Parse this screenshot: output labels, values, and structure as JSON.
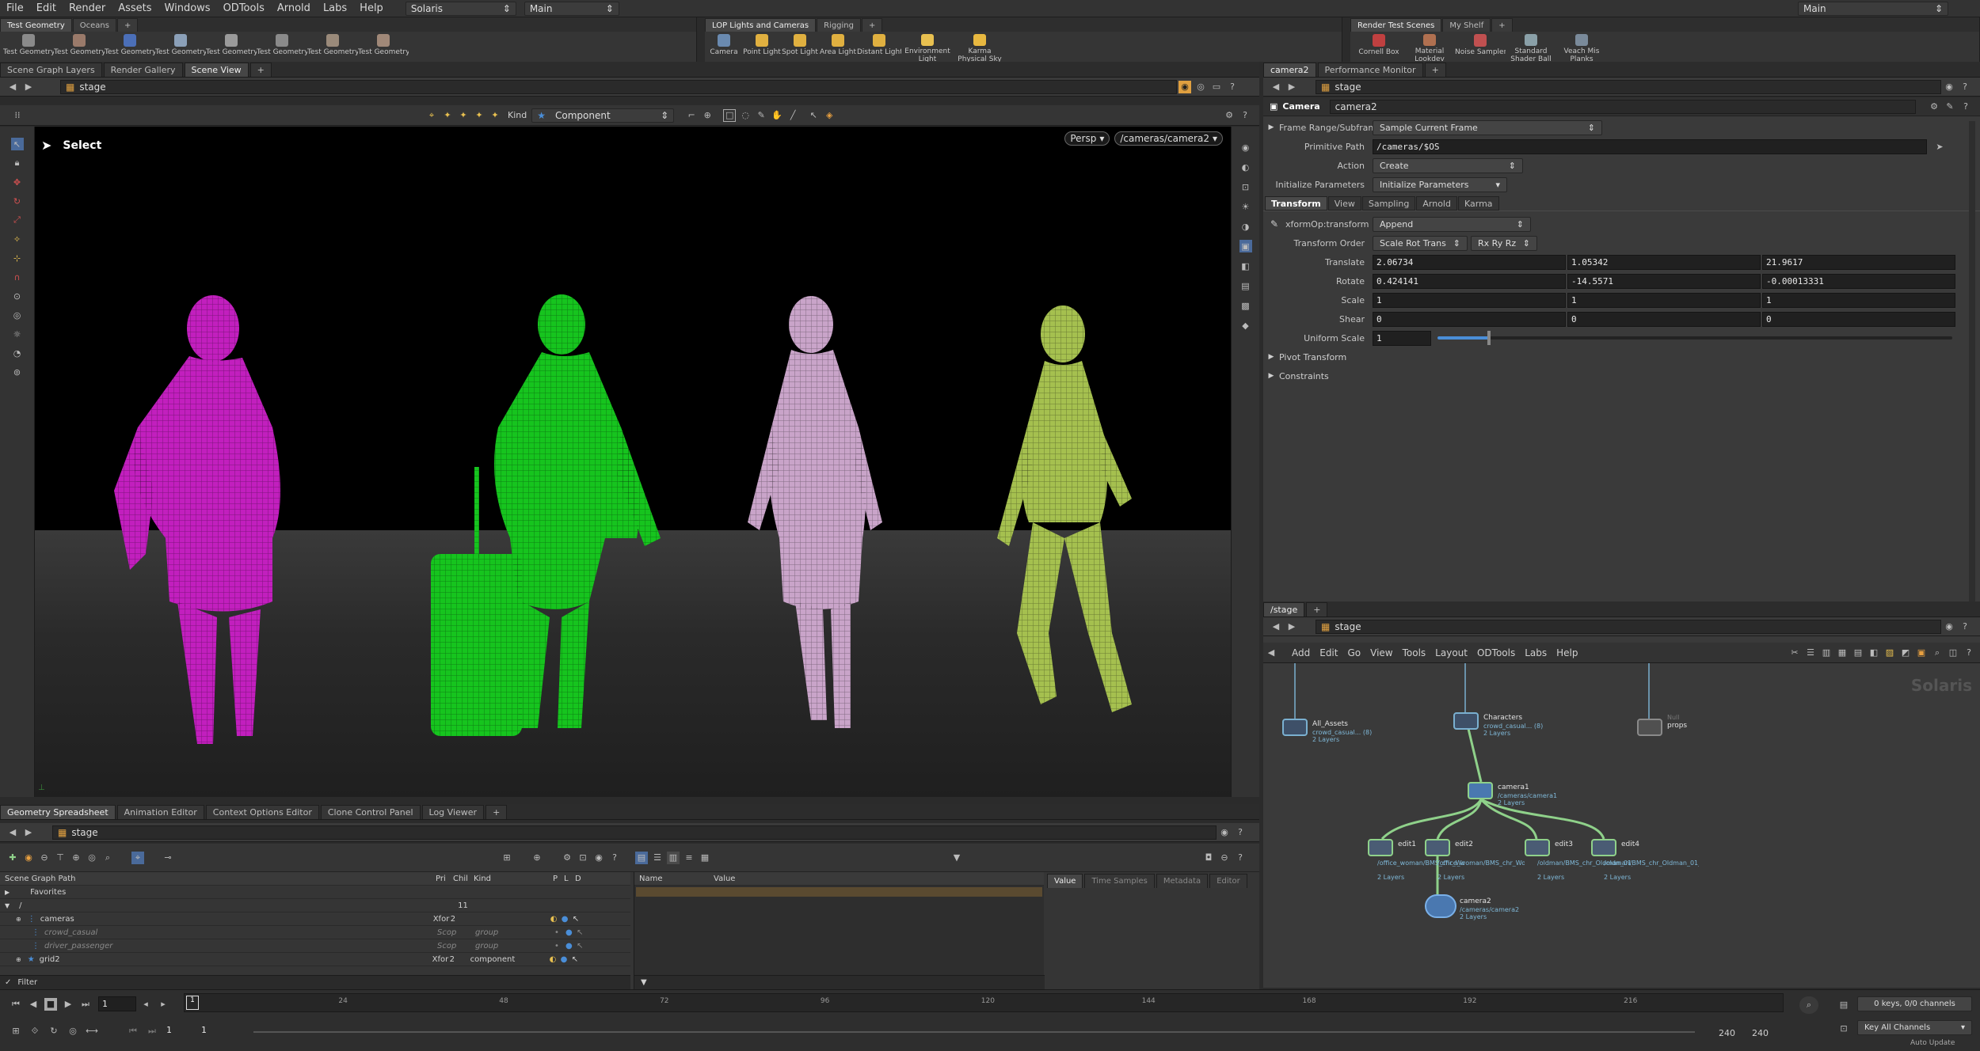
{
  "menubar": {
    "items": [
      "File",
      "Edit",
      "Render",
      "Assets",
      "Windows",
      "ODTools",
      "Arnold",
      "Labs",
      "Help"
    ],
    "desktop": "Solaris",
    "context": "Main",
    "right_context": "Main"
  },
  "shelf": {
    "left": {
      "tabs": [
        "Test Geometry",
        "Oceans"
      ],
      "tools": [
        "Test Geometry: C",
        "Test Geometry: P",
        "Test Geometry: R",
        "Test Geometry: S",
        "Test Geometry: S",
        "Test Geometry: T",
        "Test Geometry: T",
        "Test Geometry: T"
      ]
    },
    "mid": {
      "tabs": [
        "LOP Lights and Cameras",
        "Rigging"
      ],
      "tools": [
        "Camera",
        "Point Light",
        "Spot Light",
        "Area Light",
        "Distant Light",
        "Environment Light",
        "Karma Physical Sky"
      ]
    },
    "right": {
      "tabs": [
        "Render Test Scenes",
        "My Shelf"
      ],
      "tools": [
        "Cornell Box",
        "Material Lookdev",
        "Noise Sampler",
        "Standard Shader Ball",
        "Veach Mis Planks"
      ]
    }
  },
  "viewer": {
    "tabs": [
      "Scene Graph Layers",
      "Render Gallery",
      "Scene View"
    ],
    "path": "stage",
    "kind_label": "Kind",
    "kind_value": "Component",
    "select_label": "Select",
    "persp": "Persp",
    "camera": "/cameras/camera2"
  },
  "params": {
    "tabs": [
      "camera2",
      "Performance Monitor"
    ],
    "path": "stage",
    "node_type": "Camera",
    "node_name": "camera2",
    "frame_range_label": "Frame Range/Subframes",
    "frame_range_value": "Sample Current Frame",
    "primitive_path_label": "Primitive Path",
    "primitive_path_value": "/cameras/$OS",
    "action_label": "Action",
    "action_value": "Create",
    "init_label": "Initialize Parameters",
    "init_value": "Initialize Parameters",
    "sub_tabs": [
      "Transform",
      "View",
      "Sampling",
      "Arnold",
      "Karma"
    ],
    "xform_label": "xformOp:transform",
    "xform_value": "Append",
    "order_label": "Transform Order",
    "order_value": "Scale Rot Trans",
    "rot_order": "Rx Ry Rz",
    "translate_label": "Translate",
    "translate": [
      "2.06734",
      "1.05342",
      "21.9617"
    ],
    "rotate_label": "Rotate",
    "rotate": [
      "0.424141",
      "-14.5571",
      "-0.00013331"
    ],
    "scale_label": "Scale",
    "scale": [
      "1",
      "1",
      "1"
    ],
    "shear_label": "Shear",
    "shear": [
      "0",
      "0",
      "0"
    ],
    "uniform_label": "Uniform Scale",
    "uniform_value": "1",
    "uniform_fraction": 0.1,
    "pivot_label": "Pivot Transform",
    "constraints_label": "Constraints"
  },
  "network": {
    "tab": "/stage",
    "path": "stage",
    "menu": [
      "Add",
      "Edit",
      "Go",
      "View",
      "Tools",
      "Layout",
      "ODTools",
      "Labs",
      "Help"
    ],
    "watermark": "Solaris",
    "nodes": {
      "all_assets": {
        "name": "All_Assets",
        "sub": "crowd_casual... (8)",
        "layers": "2 Layers"
      },
      "characters": {
        "name": "Characters",
        "sub": "crowd_casual... (8)",
        "layers": "2 Layers"
      },
      "props": {
        "name": "props",
        "null": "Null"
      },
      "camera1": {
        "name": "camera1",
        "sub": "/cameras/camera1",
        "layers": "2 Layers"
      },
      "edit1": {
        "name": "edit1",
        "sub": "/office_woman/BMS_chr_Woman_01_Idle1_RdUmbrella... (9)",
        "layers": "2 Layers"
      },
      "edit2": {
        "name": "edit2",
        "sub": "/office_woman/BMS_chr_Woman_01_Idle1_RdUmbrella... (9)",
        "layers": "2 Layers"
      },
      "edit3": {
        "name": "edit3",
        "sub": "/oldman/BMS_chr_Oldman_01_Idle1_Greeting... (14)",
        "layers": "2 Layers"
      },
      "edit4": {
        "name": "edit4",
        "sub": "/oldman/BMS_chr_Oldman_01_Idle1_Greeting... (14)",
        "layers": "2 Layers"
      },
      "camera2": {
        "name": "camera2",
        "sub": "/cameras/camera2",
        "layers": "2 Layers"
      }
    }
  },
  "spreadsheet": {
    "tabs": [
      "Geometry Spreadsheet",
      "Animation Editor",
      "Context Options Editor",
      "Clone Control Panel",
      "Log Viewer"
    ],
    "path": "stage",
    "columns": [
      "Scene Graph Path",
      "Pri",
      "Chil",
      "Kind",
      "P",
      "L",
      "D"
    ],
    "favorites": "Favorites",
    "root": "/",
    "root_children": "11",
    "rows": [
      {
        "name": "cameras",
        "pri": "Xfor",
        "chil": "2",
        "kind": ""
      },
      {
        "name": "crowd_casual",
        "pri": "Scop",
        "chil": "",
        "kind": "group"
      },
      {
        "name": "driver_passenger",
        "pri": "Scop",
        "chil": "",
        "kind": "group"
      },
      {
        "name": "grid2",
        "pri": "Xfor",
        "chil": "2",
        "kind": "component"
      }
    ],
    "filter": "Filter",
    "name_col": "Name",
    "value_col": "Value",
    "right_tabs": [
      "Value",
      "Time Samples",
      "Metadata",
      "Editor"
    ]
  },
  "timeline": {
    "frame": "1",
    "ticks": [
      "24",
      "48",
      "72",
      "96",
      "120",
      "144",
      "168",
      "192",
      "216"
    ],
    "start": "1",
    "start2": "1",
    "end": "240",
    "end2": "240",
    "keys": "0 keys, 0/0 channels",
    "key_all": "Key All Channels",
    "auto_update": "Auto Update"
  },
  "colors": {
    "magenta": "#c21fbe",
    "green": "#16c41e",
    "pink": "#c9a4c9",
    "olive": "#a5c04f",
    "accent": "#4a8ed8"
  }
}
